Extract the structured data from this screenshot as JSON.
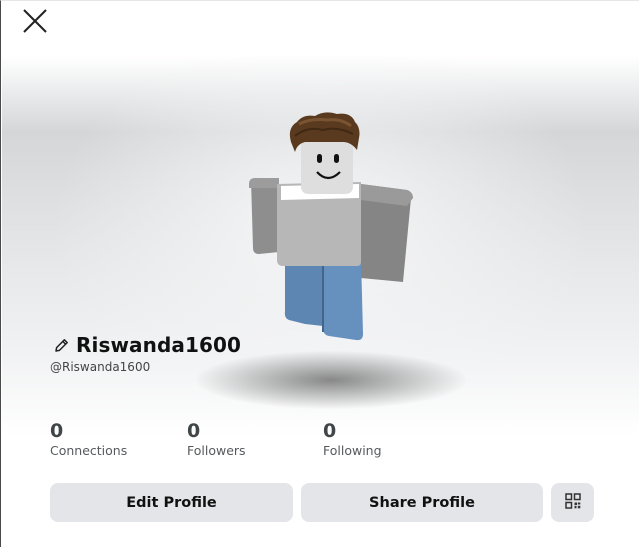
{
  "profile": {
    "display_name": "Riswanda1600",
    "username": "@Riswanda1600"
  },
  "stats": [
    {
      "value": "0",
      "label": "Connections"
    },
    {
      "value": "0",
      "label": "Followers"
    },
    {
      "value": "0",
      "label": "Following"
    }
  ],
  "actions": {
    "edit_label": "Edit Profile",
    "share_label": "Share Profile"
  },
  "icons": {
    "close": "close-icon",
    "edit": "pencil-icon",
    "qr": "qr-code-icon"
  },
  "colors": {
    "button_bg": "#e4e5e8",
    "stat_number": "#404548",
    "text": "#111111"
  }
}
